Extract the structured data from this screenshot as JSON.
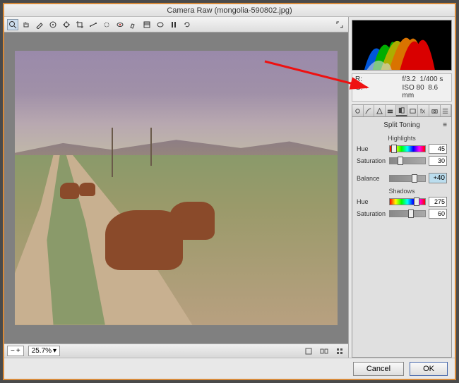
{
  "title": "Camera Raw (mongolia-590802.jpg)",
  "toolbar": {
    "tools": [
      "zoom",
      "hand",
      "eyedropper",
      "sampler",
      "crop",
      "straighten",
      "spot",
      "redeye",
      "brush",
      "grad",
      "radial",
      "prefs",
      "rotate-ccw",
      "rotate-cw"
    ]
  },
  "zoom": "25.7%",
  "info": {
    "r": "R:",
    "g": "G:",
    "aperture": "f/3.2",
    "shutter": "1/400 s",
    "iso": "ISO 80",
    "focal": "8.6 mm"
  },
  "panel": {
    "title": "Split Toning",
    "highlights": {
      "label": "Highlights",
      "hue": {
        "label": "Hue",
        "value": 45
      },
      "sat": {
        "label": "Saturation",
        "value": 30
      }
    },
    "balance": {
      "label": "Balance",
      "value": 40
    },
    "shadows": {
      "label": "Shadows",
      "hue": {
        "label": "Hue",
        "value": 275
      },
      "sat": {
        "label": "Saturation",
        "value": 60
      }
    }
  },
  "buttons": {
    "cancel": "Cancel",
    "ok": "OK"
  }
}
